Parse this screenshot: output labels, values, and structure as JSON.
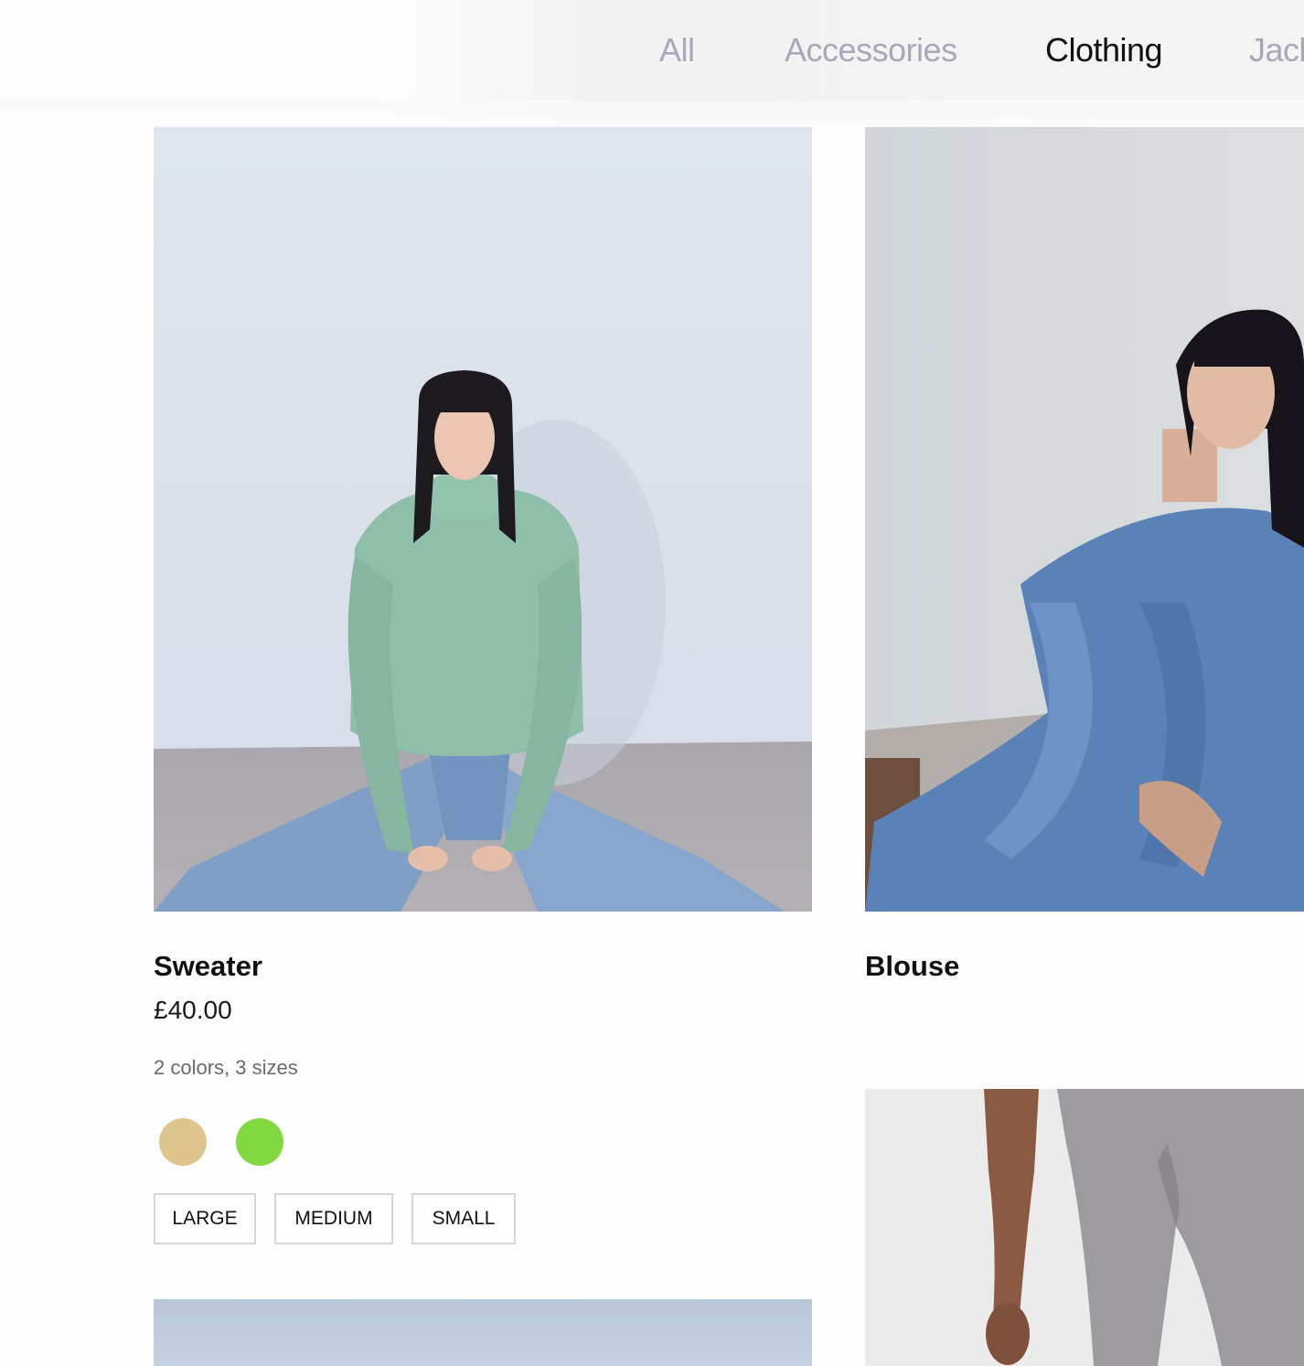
{
  "categories": {
    "all": "All",
    "accessories": "Accessories",
    "clothing": "Clothing",
    "jackets": "Jack",
    "active": "Clothing"
  },
  "products": {
    "sweater": {
      "name": "Sweater",
      "price": "£40.00",
      "variants": "2 colors, 3 sizes",
      "colors": [
        "#dec48d",
        "#7fd93f"
      ],
      "sizes": [
        "LARGE",
        "MEDIUM",
        "SMALL"
      ]
    },
    "blouse": {
      "name": "Blouse"
    }
  }
}
